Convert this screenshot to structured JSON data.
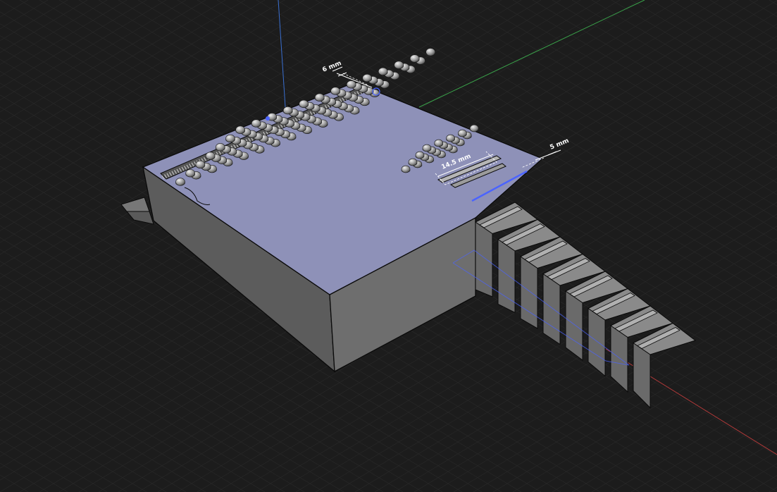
{
  "viewport": {
    "background_color": "#1c1c1c",
    "grid_color": "#2a2a2a",
    "axis_colors": {
      "x": "#b33a3a",
      "y": "#3aa24a",
      "z": "#3a6fd0"
    }
  },
  "model": {
    "top_color": "#8e91b8",
    "left_side_color": "#5c5c5c",
    "front_side_color": "#6e6e6e",
    "stair_color": "#8a8a8a",
    "edge_color": "#0a0a0a",
    "selection_color": "#4b64ff"
  },
  "dimensions": {
    "top_left": "6 mm",
    "stairs_right": "5 mm",
    "center": "14.5 mm"
  }
}
